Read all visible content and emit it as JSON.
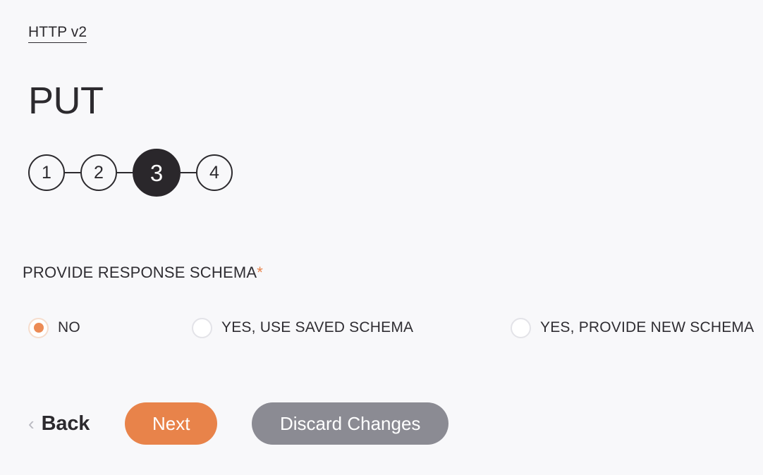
{
  "breadcrumb": {
    "link_label": "HTTP v2"
  },
  "header": {
    "title": "PUT"
  },
  "stepper": {
    "steps": [
      {
        "label": "1",
        "state": "inactive"
      },
      {
        "label": "2",
        "state": "inactive"
      },
      {
        "label": "3",
        "state": "active"
      },
      {
        "label": "4",
        "state": "inactive"
      }
    ],
    "current_step": "3",
    "total_steps": "4"
  },
  "form": {
    "field_label": "PROVIDE RESPONSE SCHEMA",
    "required_marker": "*",
    "required_color": "#e8834a",
    "options": [
      {
        "label": "NO",
        "selected": true
      },
      {
        "label": "YES, USE SAVED SCHEMA",
        "selected": false
      },
      {
        "label": "YES, PROVIDE NEW SCHEMA",
        "selected": false
      }
    ]
  },
  "actions": {
    "back_chevron": "‹",
    "back_label": "Back",
    "next_label": "Next",
    "discard_label": "Discard Changes"
  },
  "colors": {
    "background": "#f8f8fa",
    "accent_orange": "#e8834a",
    "radio_selected": "#ec8b55",
    "neutral_gray": "#8b8b93",
    "active_step": "#2a272b",
    "text": "#2c2a2e"
  }
}
